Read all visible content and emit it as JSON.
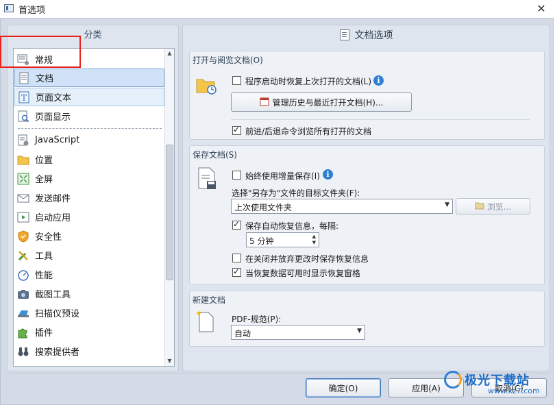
{
  "window": {
    "title": "首选项",
    "close_glyph": "✕"
  },
  "left": {
    "header": "分类",
    "items": [
      {
        "label": "常规",
        "icon": "settings-list-icon"
      },
      {
        "label": "文档",
        "icon": "document-icon"
      },
      {
        "label": "页面文本",
        "icon": "text-icon"
      },
      {
        "label": "页面显示",
        "icon": "page-magnify-icon"
      },
      {
        "label": "JavaScript",
        "icon": "script-icon"
      },
      {
        "label": "位置",
        "icon": "folder-open-icon"
      },
      {
        "label": "全屏",
        "icon": "fullscreen-icon"
      },
      {
        "label": "发送邮件",
        "icon": "mail-icon"
      },
      {
        "label": "启动应用",
        "icon": "play-icon"
      },
      {
        "label": "安全性",
        "icon": "shield-icon"
      },
      {
        "label": "工具",
        "icon": "tools-icon"
      },
      {
        "label": "性能",
        "icon": "gauge-icon"
      },
      {
        "label": "截图工具",
        "icon": "camera-icon"
      },
      {
        "label": "扫描仪预设",
        "icon": "scanner-icon"
      },
      {
        "label": "插件",
        "icon": "puzzle-icon"
      },
      {
        "label": "搜索提供者",
        "icon": "binoculars-icon"
      }
    ]
  },
  "right": {
    "header": "文档选项",
    "open_group": {
      "title": "打开与阅览文档(O)",
      "restore_label": "程序启动时恢复上次打开的文档(L)",
      "restore_checked": false,
      "manage_history_button": "管理历史与最近打开文档(H)...",
      "nav_label": "前进/后退命令浏览所有打开的文档",
      "nav_checked": true
    },
    "save_group": {
      "title": "保存文档(S)",
      "incremental_label": "始终使用增量保存(I)",
      "incremental_checked": false,
      "target_folder_label": "选择\"另存为\"文件的目标文件夹(F):",
      "target_folder_value": "上次使用文件夹",
      "browse_button": "浏览...",
      "autosave_label": "保存自动恢复信息，每隔:",
      "autosave_checked": true,
      "interval_value": "5 分钟",
      "discard_label": "在关闭并放弃更改时保存恢复信息",
      "discard_checked": false,
      "show_recovery_label": "当恢复数据可用时显示恢复窗格",
      "show_recovery_checked": true
    },
    "new_group": {
      "title": "新建文档",
      "pdf_spec_label": "PDF-规范(P):",
      "pdf_spec_value": "自动"
    }
  },
  "footer": {
    "ok_button": "确定(O)",
    "apply_button": "应用(A)",
    "cancel_button": "取消(C)"
  },
  "watermark": {
    "text": "极光下载站",
    "url": "www.xz7.com"
  },
  "colors": {
    "accent": "#2f80d1",
    "annotation": "#e8231e",
    "selected": "#cfe2f7"
  }
}
